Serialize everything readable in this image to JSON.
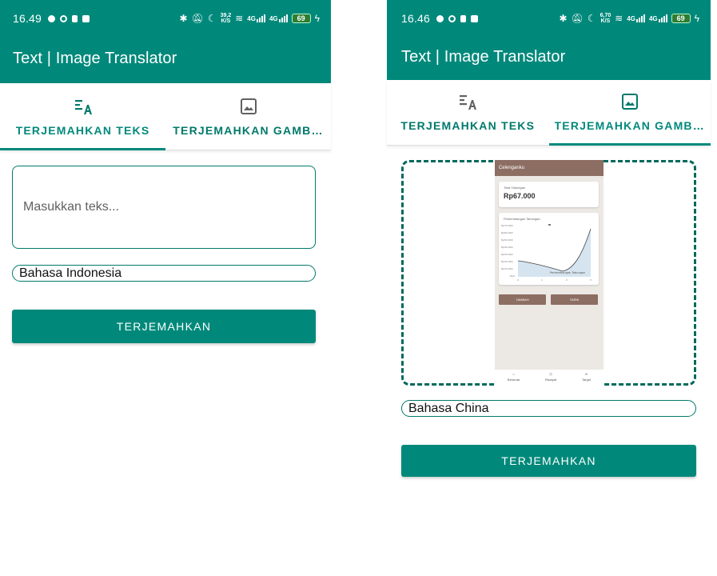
{
  "screens": [
    {
      "status": {
        "time": "16.49",
        "net_speed_value": "39,2",
        "net_speed_unit": "K/S",
        "signal_1": "4G",
        "signal_2": "4G",
        "battery": "69"
      },
      "app_title": "Text | Image Translator",
      "tabs": [
        {
          "label": "TERJEMAHKAN TEKS",
          "icon": "translate-text-icon",
          "active": true
        },
        {
          "label": "TERJEMAHKAN GAMB…",
          "icon": "image-icon",
          "active": false
        }
      ],
      "text_input": {
        "value": "",
        "placeholder": "Masukkan teks..."
      },
      "language": "Bahasa Indonesia",
      "translate_button": "TERJEMAHKAN"
    },
    {
      "status": {
        "time": "16.46",
        "net_speed_value": "6,70",
        "net_speed_unit": "K/S",
        "signal_1": "4G",
        "signal_2": "4G",
        "battery": "69"
      },
      "app_title": "Text | Image Translator",
      "tabs": [
        {
          "label": "TERJEMAHKAN TEKS",
          "icon": "translate-text-icon",
          "active": false
        },
        {
          "label": "TERJEMAHKAN GAMB…",
          "icon": "image-icon",
          "active": true
        }
      ],
      "image_preview": {
        "app_bar_title": "Celenganku",
        "total_label": "Total Tabungan",
        "total_value": "Rp67.000",
        "chart_title": "Perkembangan Tabungan",
        "chart_legend": "Perkembangan Tabungan",
        "y_ticks": [
          "Rp70.000",
          "Rp60.000",
          "Rp50.000",
          "Rp40.000",
          "Rp30.000",
          "Rp20.000",
          "Rp10.000",
          "Rp0"
        ],
        "x_ticks": [
          "0",
          "1",
          "2",
          "3"
        ],
        "buttons": [
          "TAMBAH",
          "TARIK"
        ],
        "nav": [
          "Beranda",
          "Riwayat",
          "Target"
        ]
      },
      "language": "Bahasa China",
      "translate_button": "TERJEMAHKAN"
    }
  ],
  "colors": {
    "primary": "#00897b",
    "primary_dark": "#00796b",
    "preview_brown": "#8d6e63"
  }
}
